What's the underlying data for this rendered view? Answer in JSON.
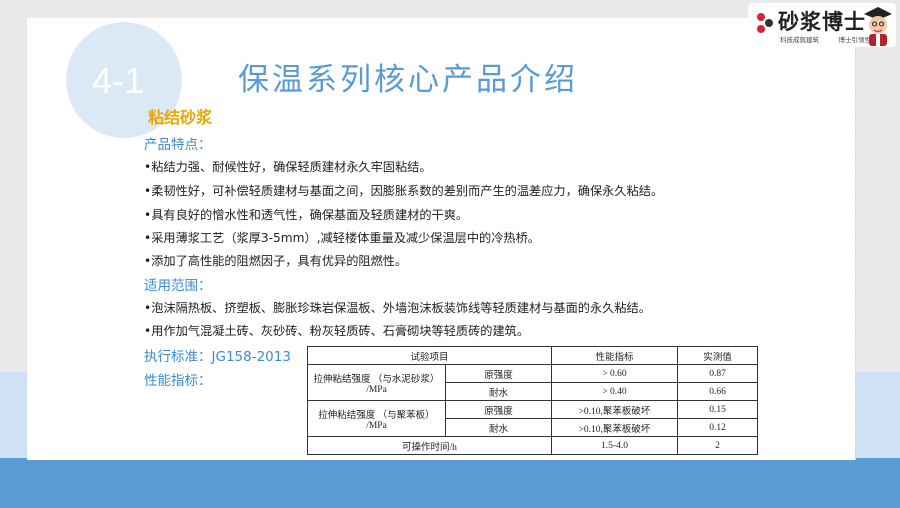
{
  "logo": {
    "name": "砂浆博士",
    "slogan": "科技成就建筑　　　博士引领世界"
  },
  "slide": {
    "number": "4-1",
    "title": "保温系列核心产品介绍",
    "subtitle": "粘结砂浆",
    "features_heading": "产品特点：",
    "features": [
      "•粘结力强、耐候性好，确保轻质建材永久牢固粘结。",
      "•柔韧性好，可补偿轻质建材与基面之间，因膨胀系数的差别而产生的温差应力，确保永久粘结。",
      "•具有良好的憎水性和透气性，确保基面及轻质建材的干爽。",
      "•采用薄浆工艺（浆厚3-5mm）,减轻楼体重量及减少保温层中的冷热桥。",
      "•添加了高性能的阻燃因子，具有优异的阻燃性。"
    ],
    "scope_heading": "适用范围：",
    "scope": [
      "•泡沫隔热板、挤塑板、膨胀珍珠岩保温板、外墙泡沫板装饰线等轻质建材与基面的永久粘结。",
      "•用作加气混凝土砖、灰砂砖、粉灰轻质砖、石膏砌块等轻质砖的建筑。"
    ],
    "standard": "执行标准：JG158-2013",
    "performance_heading": "性能指标："
  },
  "table": {
    "headers": [
      "试验项目",
      "性能指标",
      "实测值"
    ],
    "group1": {
      "label_line1": "拉伸粘结强度 （与水泥砂浆）",
      "label_line2": "/MPa",
      "rows": [
        {
          "cond": "原强度",
          "spec": "> 0.60",
          "value": "0.87"
        },
        {
          "cond": "耐水",
          "spec": "> 0.40",
          "value": "0.66"
        }
      ]
    },
    "group2": {
      "label_line1": "拉伸粘结强度 （与聚苯板）",
      "label_line2": "/MPa",
      "rows": [
        {
          "cond": "原强度",
          "spec": ">0.10,聚苯板破坏",
          "value": "0.15"
        },
        {
          "cond": "耐水",
          "spec": ">0.10,聚苯板破坏",
          "value": "0.12"
        }
      ]
    },
    "last": {
      "label": "可操作时间/h",
      "spec": "1.5-4.0",
      "value": "2"
    }
  },
  "colors": {
    "accent": "#5b9bd5",
    "heading": "#3b8bd6",
    "subtitle": "#f0a500"
  }
}
